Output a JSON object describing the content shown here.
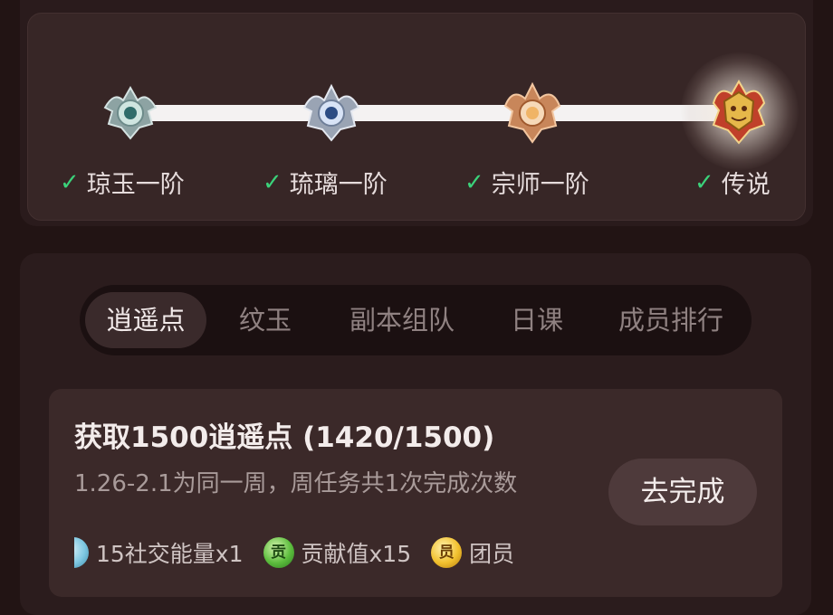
{
  "ranks": [
    {
      "label": "琼玉一阶",
      "achieved": true,
      "medal": "jade-medal-icon"
    },
    {
      "label": "琉璃一阶",
      "achieved": true,
      "medal": "glass-medal-icon"
    },
    {
      "label": "宗师一阶",
      "achieved": true,
      "medal": "master-medal-icon"
    },
    {
      "label": "传说",
      "achieved": true,
      "medal": "legend-medal-icon"
    }
  ],
  "check_symbol": "✓",
  "tabs": [
    {
      "label": "逍遥点",
      "active": true
    },
    {
      "label": "纹玉",
      "active": false
    },
    {
      "label": "副本组队",
      "active": false
    },
    {
      "label": "日课",
      "active": false
    },
    {
      "label": "成员排行",
      "active": false
    }
  ],
  "task": {
    "title": "获取1500逍遥点 (1420/1500)",
    "progress": {
      "current": 1420,
      "target": 1500
    },
    "description": "1.26-2.1为同一周，周任务共1次完成次数",
    "button_label": "去完成",
    "rewards": [
      {
        "icon": "social-energy-icon",
        "label": "15社交能量x1",
        "glyph": ""
      },
      {
        "icon": "contribution-icon",
        "label": "贡献值x15",
        "glyph": "贡"
      },
      {
        "icon": "member-icon",
        "label": "团员",
        "glyph": "员"
      }
    ]
  },
  "colors": {
    "background": "#221414",
    "card": "#372626",
    "check": "#3bd27a",
    "active_tab": "#3a2a2b"
  }
}
